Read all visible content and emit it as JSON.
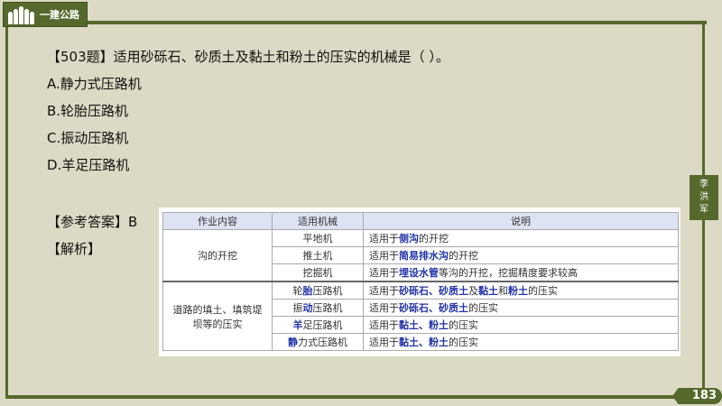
{
  "header": {
    "brand": "一建公路"
  },
  "question": {
    "stem": "【503题】适用砂砾石、砂质土及黏土和粉土的压实的机械是（    ）。",
    "options": [
      "A.静力式压路机",
      "B.轮胎压路机",
      "C.振动压路机",
      "D.羊足压路机"
    ],
    "answer": "【参考答案】B",
    "analysis": "【解析】"
  },
  "table": {
    "headers": [
      "作业内容",
      "适用机械",
      "说明"
    ],
    "groups": [
      {
        "work": "沟的开挖",
        "rows": [
          {
            "machine": [
              {
                "t": "平地机"
              }
            ],
            "desc": [
              {
                "t": "适用于"
              },
              {
                "t": "侧沟",
                "b": true
              },
              {
                "t": "的开挖"
              }
            ]
          },
          {
            "machine": [
              {
                "t": "推土机"
              }
            ],
            "desc": [
              {
                "t": "适用于"
              },
              {
                "t": "简易排水沟",
                "b": true
              },
              {
                "t": "的开挖"
              }
            ]
          },
          {
            "machine": [
              {
                "t": "挖掘机"
              }
            ],
            "desc": [
              {
                "t": "适用于"
              },
              {
                "t": "埋设水管",
                "b": true
              },
              {
                "t": "等沟的开挖，挖掘精度要求较高"
              }
            ]
          }
        ]
      },
      {
        "work": "道路的填土、填筑堤坝等的压实",
        "rows": [
          {
            "machine": [
              {
                "t": "轮"
              },
              {
                "t": "胎",
                "b": true
              },
              {
                "t": "压路机"
              }
            ],
            "desc": [
              {
                "t": "适用于"
              },
              {
                "t": "砂砾石、砂质土",
                "b": true
              },
              {
                "t": "及"
              },
              {
                "t": "黏土",
                "b": true
              },
              {
                "t": "和"
              },
              {
                "t": "粉土",
                "b": true
              },
              {
                "t": "的压实"
              }
            ]
          },
          {
            "machine": [
              {
                "t": "振"
              },
              {
                "t": "动",
                "b": true
              },
              {
                "t": "压路机"
              }
            ],
            "desc": [
              {
                "t": "适用于"
              },
              {
                "t": "砂砾石、砂质土",
                "b": true
              },
              {
                "t": "的压实"
              }
            ]
          },
          {
            "machine": [
              {
                "t": "羊",
                "b": true
              },
              {
                "t": "足压路机"
              }
            ],
            "desc": [
              {
                "t": "适用于"
              },
              {
                "t": "黏土、粉土",
                "b": true
              },
              {
                "t": "的压实"
              }
            ]
          },
          {
            "machine": [
              {
                "t": "静",
                "b": true
              },
              {
                "t": "力式压路机"
              }
            ],
            "desc": [
              {
                "t": "适用于"
              },
              {
                "t": "黏土、粉土",
                "b": true
              },
              {
                "t": "的压实"
              }
            ]
          }
        ]
      }
    ]
  },
  "side_tab": {
    "chars": [
      "李",
      "洪",
      "军"
    ]
  },
  "page_number": "183",
  "colors": {
    "accent": "#56692c",
    "background": "#dcd9c4",
    "highlight": "#2233aa",
    "header_bg": "#dde3f3"
  }
}
